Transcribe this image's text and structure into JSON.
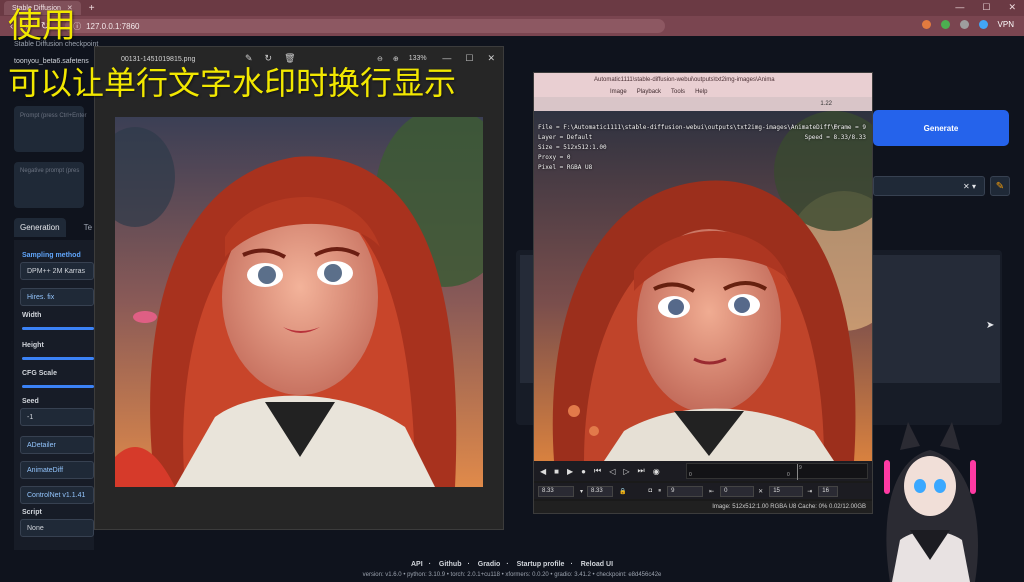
{
  "browser": {
    "tab_title": "Stable Diffusion",
    "url": "127.0.0.1:7860",
    "vpn_label": "VPN"
  },
  "watermark": {
    "line1": "使用",
    "line2": "可以让单行文字水印时换行显示"
  },
  "webui": {
    "checkpoint_label": "Stable Diffusion checkpoint",
    "checkpoint_value": "toonyou_beta6.safetens",
    "prompt_placeholder": "Prompt (press Ctrl+Enter",
    "negative_placeholder": "Negative prompt (pres",
    "tabs": [
      "Generation",
      "Te"
    ],
    "sampling_label": "Sampling method",
    "sampling_value": "DPM++ 2M Karras",
    "hires": "Hires. fix",
    "width_label": "Width",
    "height_label": "Height",
    "cfg_label": "CFG Scale",
    "seed_label": "Seed",
    "seed_value": "-1",
    "adetailer": "ADetailer",
    "animatediff": "AnimateDiff",
    "controlnet": "ControlNet v1.1.41",
    "script_label": "Script",
    "script_value": "None",
    "generate": "Generate",
    "styles_clear": "✕ ▾",
    "footer_links": [
      "API",
      "Github",
      "Gradio",
      "Startup profile",
      "Reload UI"
    ],
    "footer_info": "version: v1.6.0  •  python: 3.10.9  •  torch: 2.0.1+cu118  •  xformers: 0.0.20  •  gradio: 3.41.2  •  checkpoint: e8d456c42e"
  },
  "viewer1": {
    "filename": "00131-1451019815.png",
    "zoom": "133%"
  },
  "viewer2": {
    "title": "Automatic1111\\stable-diffusion-webui\\outputs\\txt2img-images\\Anima",
    "menu": [
      "Image",
      "Playback",
      "Tools",
      "Help"
    ],
    "toolbar_value": "1.22",
    "osd_lines": [
      "File  = F:\\Automatic1111\\stable-diffusion-webui\\outputs\\txt2img-images\\AnimateDiff\\00007-1451019815",
      "Layer = Default",
      "Size  = 512x512:1.00",
      "Proxy = 0",
      "Pixel = RGBA U8"
    ],
    "osd_right": [
      "Frame = 9",
      "Speed = 8.33/8.33"
    ],
    "timeline_nums": [
      "0",
      "0",
      "9"
    ],
    "fps_left": "8.33",
    "fps_right": "8.33",
    "frame_current": "9",
    "frame_start": "0",
    "frame_end": "15",
    "frame_total": "16",
    "status": "Image: 512x512:1.00 RGBA U8  Cache: 0% 0.02/12.00GB"
  }
}
